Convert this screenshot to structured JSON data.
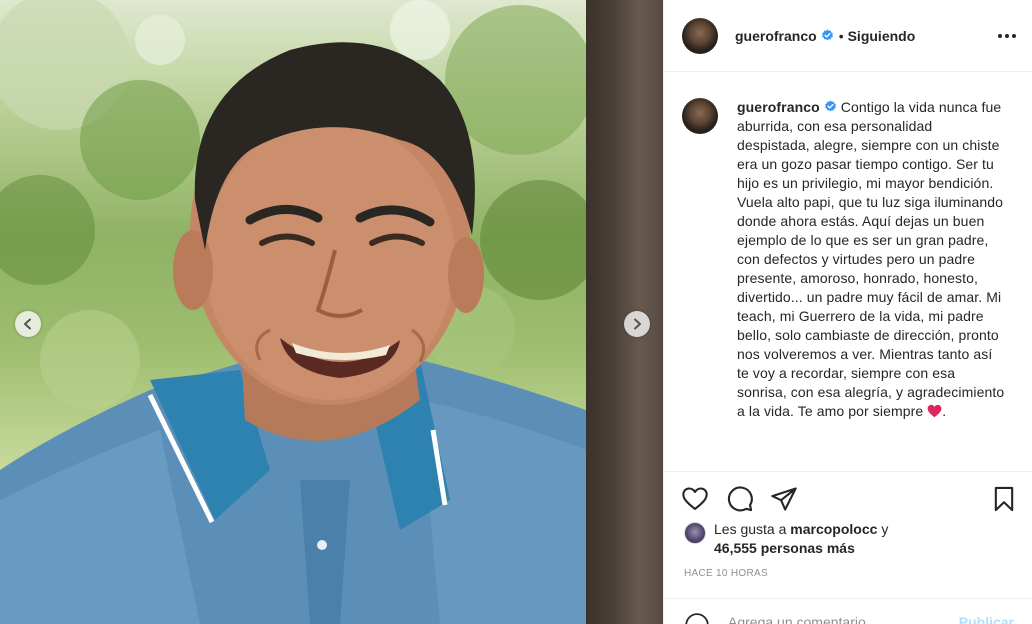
{
  "post": {
    "username": "guerofranco",
    "follow_status": "Siguiendo",
    "separator": "•",
    "caption": "Contigo la vida nunca fue aburrida, con esa personalidad despistada, alegre, siempre con un chiste era un gozo pasar tiempo contigo. Ser tu hijo es un privilegio, mi mayor bendición. Vuela alto papi, que tu luz siga iluminando donde ahora estás. Aquí dejas un buen ejemplo de lo que es ser un gran padre, con defectos y virtudes pero un padre presente, amoroso, honrado, honesto, divertido... un padre muy fácil de amar. Mi teach, mi Guerrero de la vida, mi padre bello, solo cambiaste de dirección, pronto nos volveremos a ver. Mientras tanto así te voy a recordar, siempre con esa sonrisa, con esa alegría, y agradecimiento a la vida. Te amo por siempre",
    "caption_end": "."
  },
  "likes": {
    "prefix": "Les gusta a",
    "liker": "marcopolocc",
    "conj": "y",
    "count_text": "46,555 personas más"
  },
  "timestamp": "HACE 10 HORAS",
  "comment": {
    "placeholder": "Agrega un comentario...",
    "publish": "Publicar"
  },
  "icons": {
    "verified": "verified-badge-icon",
    "more": "more-options-icon",
    "like": "heart-icon",
    "comment": "comment-bubble-icon",
    "share": "paper-plane-icon",
    "save": "bookmark-icon",
    "prev": "chevron-left-icon",
    "next": "chevron-right-icon",
    "emoji": "emoji-smiley-icon",
    "caption_emoji": "red-heart-emoji"
  },
  "colors": {
    "verified_blue": "#3897f0",
    "text": "#262626",
    "secondary": "#8e8e8e",
    "publish_disabled": "#b2dffc",
    "heart_red": "#e0245e"
  }
}
